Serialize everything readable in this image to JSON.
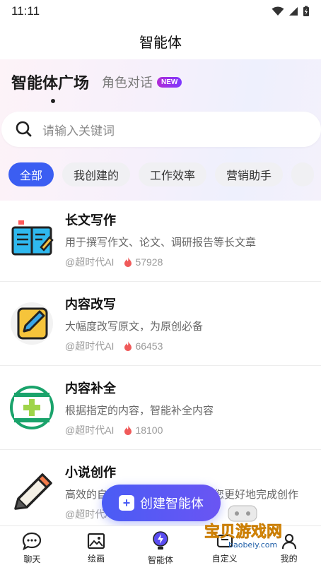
{
  "status": {
    "time": "11:11"
  },
  "header": {
    "title": "智能体"
  },
  "top_tabs": {
    "active": "智能体广场",
    "other": "角色对话",
    "badge": "NEW"
  },
  "search": {
    "placeholder": "请输入关键词"
  },
  "chips": [
    "全部",
    "我创建的",
    "工作效率",
    "营销助手",
    ""
  ],
  "items": [
    {
      "title": "长文写作",
      "desc": "用于撰写作文、论文、调研报告等长文章",
      "author": "@超时代AI",
      "count": "57928",
      "icon": "notebook-icon"
    },
    {
      "title": "内容改写",
      "desc": "大幅度改写原文，为原创必备",
      "author": "@超时代AI",
      "count": "66453",
      "icon": "edit-pencil-icon"
    },
    {
      "title": "内容补全",
      "desc": "根据指定的内容，智能补全内容",
      "author": "@超时代AI",
      "count": "18100",
      "icon": "plus-circle-icon"
    },
    {
      "title": "小说创作",
      "desc": "高效的自动小说创作工具，帮助您更好地完成创作",
      "author": "@超时代AI",
      "count": "",
      "icon": "pencil-icon"
    }
  ],
  "fab": {
    "label": "创建智能体"
  },
  "bottom_nav": [
    {
      "label": "聊天",
      "icon": "chat-icon"
    },
    {
      "label": "绘画",
      "icon": "image-icon"
    },
    {
      "label": "智能体",
      "icon": "agent-bulb-icon",
      "active": true
    },
    {
      "label": "自定义",
      "icon": "custom-icon"
    },
    {
      "label": "我的",
      "icon": "profile-icon"
    }
  ],
  "watermark": {
    "text": "宝贝游戏网",
    "url": "baobeiy.com"
  },
  "colors": {
    "accent": "#3b5ef2",
    "fab": "#4a5cf5",
    "hot": "#f05a5a"
  }
}
